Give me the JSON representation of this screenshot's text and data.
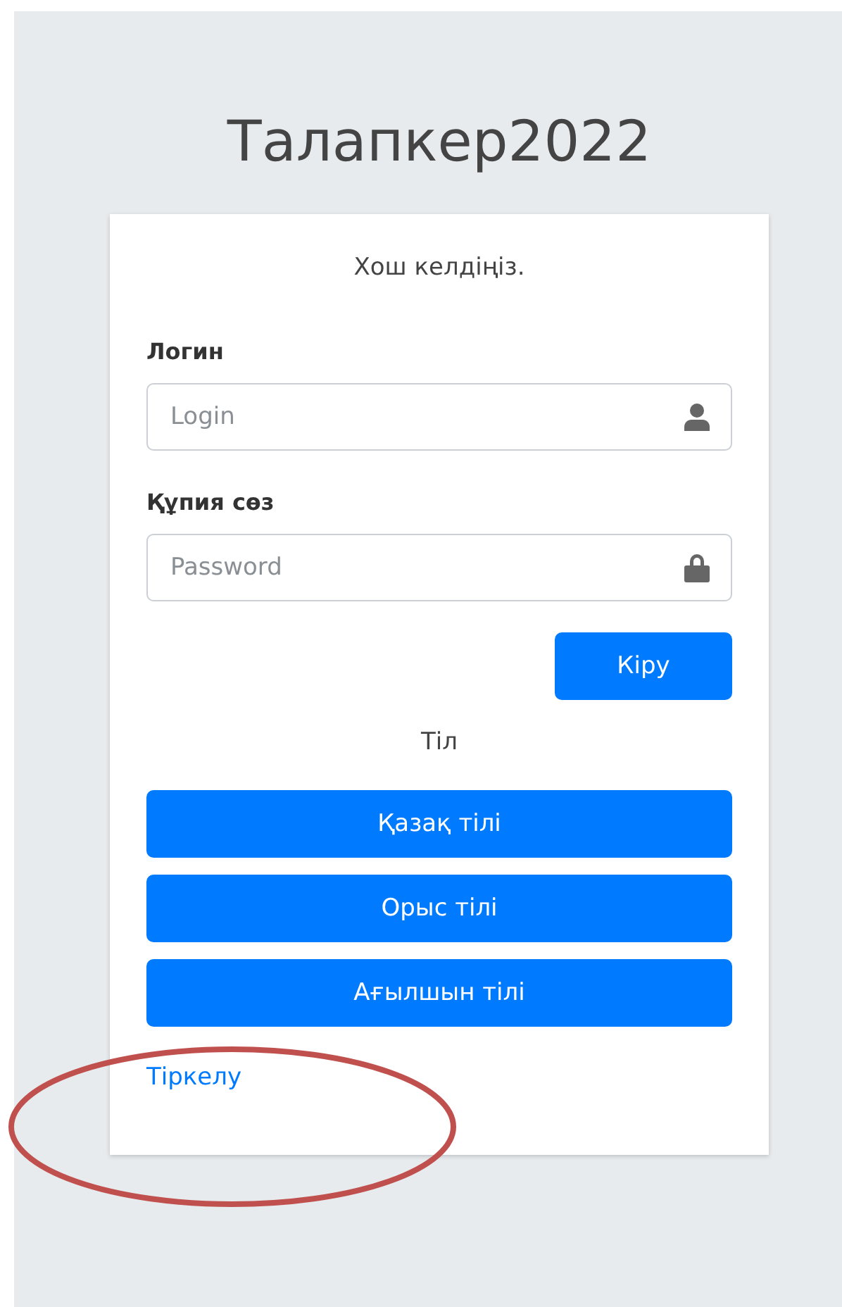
{
  "title": "Талапкер2022",
  "welcome": "Хош келдіңіз.",
  "fields": [
    {
      "label": "Логин",
      "placeholder": "Login",
      "kind": "user"
    },
    {
      "label": "Құпия сөз",
      "placeholder": "Password",
      "kind": "lock"
    }
  ],
  "submit_button": "Кіру",
  "language_heading": "Тіл",
  "language_buttons": [
    "Қазақ тілі",
    "Орыс тілі",
    "Ағылшын тілі"
  ],
  "register_link": "Тіркелу"
}
